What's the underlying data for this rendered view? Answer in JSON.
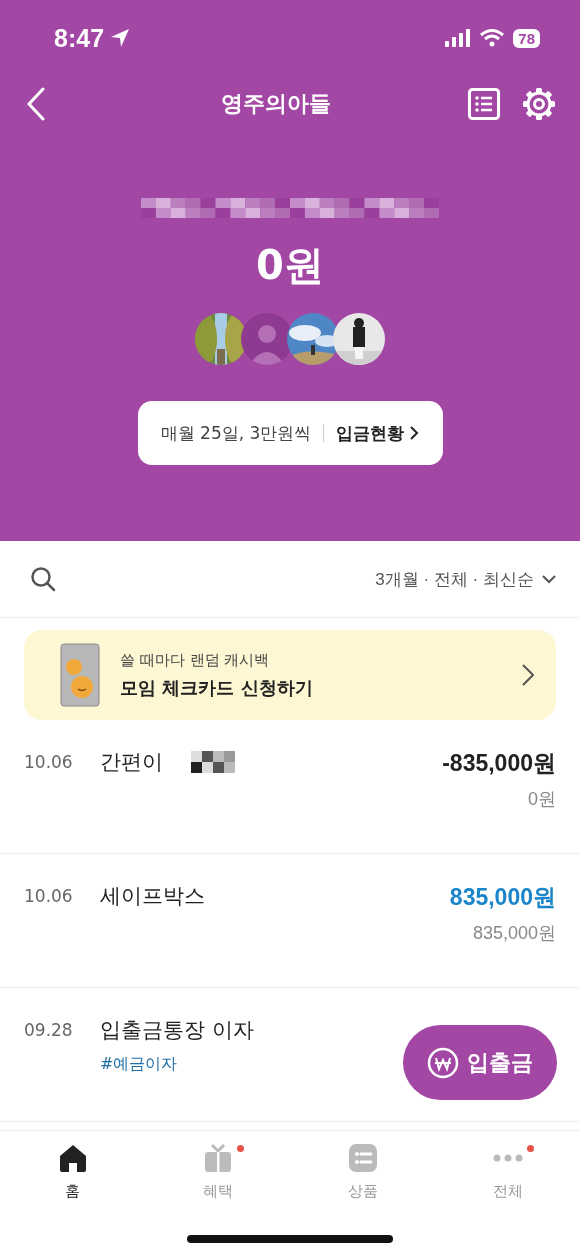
{
  "status_bar": {
    "time": "8:47",
    "battery": "78"
  },
  "header": {
    "title": "영주의아들"
  },
  "account": {
    "balance": "0원",
    "members": [
      {
        "kind": "picture"
      },
      {
        "kind": "default"
      },
      {
        "kind": "picture"
      },
      {
        "kind": "picture"
      }
    ],
    "auto_deposit": {
      "schedule": "매월 25일, 3만원씩",
      "link": "입금현황"
    }
  },
  "filter": {
    "label": "3개월 · 전체 · 최신순"
  },
  "promo": {
    "subtitle": "쓸 때마다 랜덤 캐시백",
    "title": "모임 체크카드 신청하기"
  },
  "transactions": [
    {
      "date": "10.06",
      "title": "간편이",
      "redacted": true,
      "kind": "withdrawal",
      "amount": "-835,000원",
      "balance": "0원"
    },
    {
      "date": "10.06",
      "title": "세이프박스",
      "redacted": false,
      "kind": "deposit",
      "amount": "835,000원",
      "balance": "835,000원"
    },
    {
      "date": "09.28",
      "title": "입출금통장 이자",
      "redacted": false,
      "tag": "#예금이자"
    }
  ],
  "fab": {
    "label": "입출금"
  },
  "tabs": [
    {
      "label": "홈",
      "selected": true,
      "badge": false
    },
    {
      "label": "혜택",
      "selected": false,
      "badge": true
    },
    {
      "label": "상품",
      "selected": false,
      "badge": false
    },
    {
      "label": "전체",
      "selected": false,
      "badge": true
    }
  ]
}
